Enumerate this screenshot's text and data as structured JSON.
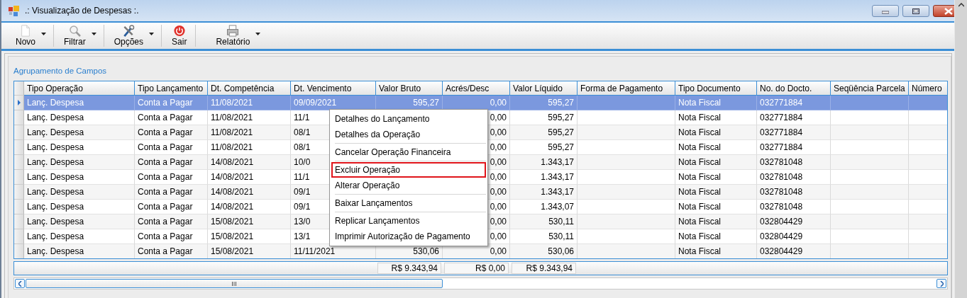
{
  "window": {
    "title": ".: Visualização de Despesas :."
  },
  "toolbar": [
    {
      "label": "Novo",
      "has_menu": true
    },
    {
      "label": "Filtrar",
      "has_menu": true
    },
    {
      "label": "Opções",
      "has_menu": true
    },
    {
      "label": "Sair",
      "has_menu": false
    },
    {
      "label": "Relatório",
      "has_menu": true
    }
  ],
  "group_title": "Agrupamento de Campos",
  "table": {
    "columns": [
      {
        "label": "Tipo Operação",
        "kind": "text"
      },
      {
        "label": "Tipo Lançamento",
        "kind": "text"
      },
      {
        "label": "Dt. Competência",
        "kind": "text"
      },
      {
        "label": "Dt. Vencimento",
        "kind": "text"
      },
      {
        "label": "Valor Bruto",
        "kind": "number",
        "total": "R$ 9.343,94"
      },
      {
        "label": "Acrés/Desc",
        "kind": "number",
        "total": "R$ 0,00"
      },
      {
        "label": "Valor Líquido",
        "kind": "number",
        "total": "R$ 9.343,94"
      },
      {
        "label": "Forma de Pagamento",
        "kind": "text"
      },
      {
        "label": "Tipo Documento",
        "kind": "text"
      },
      {
        "label": "No. do Docto.",
        "kind": "text"
      },
      {
        "label": "Seqüência Parcela",
        "kind": "text"
      },
      {
        "label": "Número",
        "kind": "text"
      }
    ],
    "rows": [
      {
        "selected": true,
        "cells": [
          "Lanç. Despesa",
          "Conta a Pagar",
          "11/08/2021",
          "09/09/2021",
          "595,27",
          "0,00",
          "595,27",
          null,
          "Nota Fiscal",
          "032771884",
          null,
          null
        ]
      },
      {
        "selected": false,
        "cells": [
          "Lanç. Despesa",
          "Conta a Pagar",
          "11/08/2021",
          "11/1",
          null,
          "0,00",
          "595,27",
          null,
          "Nota Fiscal",
          "032771884",
          null,
          null
        ]
      },
      {
        "selected": false,
        "cells": [
          "Lanç. Despesa",
          "Conta a Pagar",
          "11/08/2021",
          "08/1",
          null,
          "0,00",
          "595,27",
          null,
          "Nota Fiscal",
          "032771884",
          null,
          null
        ]
      },
      {
        "selected": false,
        "cells": [
          "Lanç. Despesa",
          "Conta a Pagar",
          "11/08/2021",
          "08/1",
          null,
          "0,00",
          "595,27",
          null,
          "Nota Fiscal",
          "032771884",
          null,
          null
        ]
      },
      {
        "selected": false,
        "cells": [
          "Lanç. Despesa",
          "Conta a Pagar",
          "14/08/2021",
          "10/0",
          null,
          "0,00",
          "1.343,17",
          null,
          "Nota Fiscal",
          "032781048",
          null,
          null
        ]
      },
      {
        "selected": false,
        "cells": [
          "Lanç. Despesa",
          "Conta a Pagar",
          "14/08/2021",
          "11/1",
          null,
          "0,00",
          "1.343,17",
          null,
          "Nota Fiscal",
          "032781048",
          null,
          null
        ]
      },
      {
        "selected": false,
        "cells": [
          "Lanç. Despesa",
          "Conta a Pagar",
          "14/08/2021",
          "09/1",
          null,
          "0,00",
          "1.343,17",
          null,
          "Nota Fiscal",
          "032781048",
          null,
          null
        ]
      },
      {
        "selected": false,
        "cells": [
          "Lanç. Despesa",
          "Conta a Pagar",
          "14/08/2021",
          "09/1",
          null,
          "0,00",
          "1.343,07",
          null,
          "Nota Fiscal",
          "032781048",
          null,
          null
        ]
      },
      {
        "selected": false,
        "cells": [
          "Lanç. Despesa",
          "Conta a Pagar",
          "15/08/2021",
          "13/0",
          null,
          "0,00",
          "530,11",
          null,
          "Nota Fiscal",
          "032804429",
          null,
          null
        ]
      },
      {
        "selected": false,
        "cells": [
          "Lanç. Despesa",
          "Conta a Pagar",
          "15/08/2021",
          "13/1",
          null,
          "0,00",
          "530,11",
          null,
          "Nota Fiscal",
          "032804429",
          null,
          null
        ]
      },
      {
        "selected": false,
        "cells": [
          "Lanç. Despesa",
          "Conta a Pagar",
          "15/08/2021",
          "11/11/2021",
          "530,06",
          "0,00",
          "530,06",
          null,
          "Nota Fiscal",
          "032804429",
          null,
          null
        ]
      }
    ]
  },
  "context_menu": [
    {
      "kind": "item",
      "label": "Detalhes do Lançamento",
      "highlighted": false
    },
    {
      "kind": "item",
      "label": "Detalhes da Operação",
      "highlighted": false
    },
    {
      "kind": "separator"
    },
    {
      "kind": "item",
      "label": "Cancelar Operação Financeira",
      "highlighted": false
    },
    {
      "kind": "separator"
    },
    {
      "kind": "item",
      "label": "Excluir Operação",
      "highlighted": true
    },
    {
      "kind": "item",
      "label": "Alterar Operação",
      "highlighted": false
    },
    {
      "kind": "separator"
    },
    {
      "kind": "item",
      "label": "Baixar Lançamentos",
      "highlighted": false
    },
    {
      "kind": "separator"
    },
    {
      "kind": "item",
      "label": "Replicar Lançamentos",
      "highlighted": false
    },
    {
      "kind": "item",
      "label": "Imprimir Autorização de Pagamento",
      "highlighted": false
    }
  ]
}
